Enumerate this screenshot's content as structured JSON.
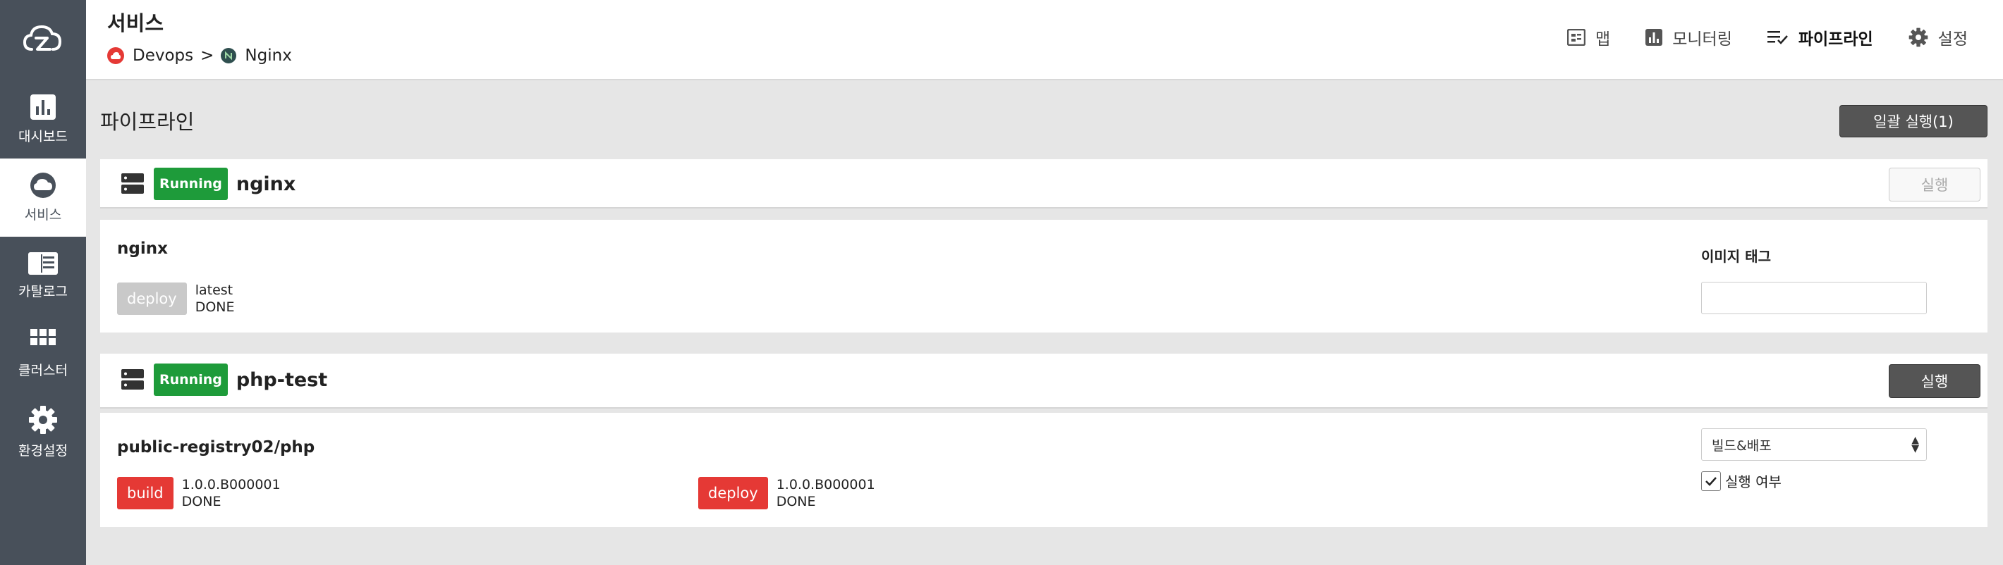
{
  "sidebar": {
    "items": [
      {
        "label": "대시보드",
        "icon": "bar-chart-icon"
      },
      {
        "label": "서비스",
        "icon": "cloud-icon",
        "active": true
      },
      {
        "label": "카탈로그",
        "icon": "catalog-icon"
      },
      {
        "label": "클러스터",
        "icon": "grid-icon"
      },
      {
        "label": "환경설정",
        "icon": "gear-icon"
      }
    ]
  },
  "header": {
    "title": "서비스",
    "breadcrumb": {
      "first": "Devops",
      "separator": ">",
      "second": "Nginx"
    },
    "nav": [
      {
        "label": "맵",
        "icon": "map-icon"
      },
      {
        "label": "모니터링",
        "icon": "monitoring-icon"
      },
      {
        "label": "파이프라인",
        "icon": "pipeline-icon",
        "active": true
      },
      {
        "label": "설정",
        "icon": "gear-icon"
      }
    ]
  },
  "main": {
    "title": "파이프라인",
    "batch_run_label": "일괄 실행(1)",
    "pipelines": [
      {
        "status": "Running",
        "name": "nginx",
        "run_label": "실행",
        "run_enabled": false,
        "repo": "nginx",
        "steps": [
          {
            "type": "deploy",
            "version": "latest",
            "state": "DONE",
            "color": "#c9c9c9"
          }
        ],
        "field_label": "이미지 태그",
        "image_tag_value": ""
      },
      {
        "status": "Running",
        "name": "php-test",
        "run_label": "실행",
        "run_enabled": true,
        "repo": "public-registry02/php",
        "steps": [
          {
            "type": "build",
            "version": "1.0.0.B000001",
            "state": "DONE",
            "color": "#e53935"
          },
          {
            "type": "deploy",
            "version": "1.0.0.B000001",
            "state": "DONE",
            "color": "#e53935"
          }
        ],
        "select_value": "빌드&배포",
        "checkbox_label": "실행 여부",
        "checkbox_checked": true
      }
    ]
  },
  "colors": {
    "sidebar": "#48505a",
    "running": "#1e9b3a",
    "step_red": "#e53935",
    "step_grey": "#c9c9c9"
  }
}
